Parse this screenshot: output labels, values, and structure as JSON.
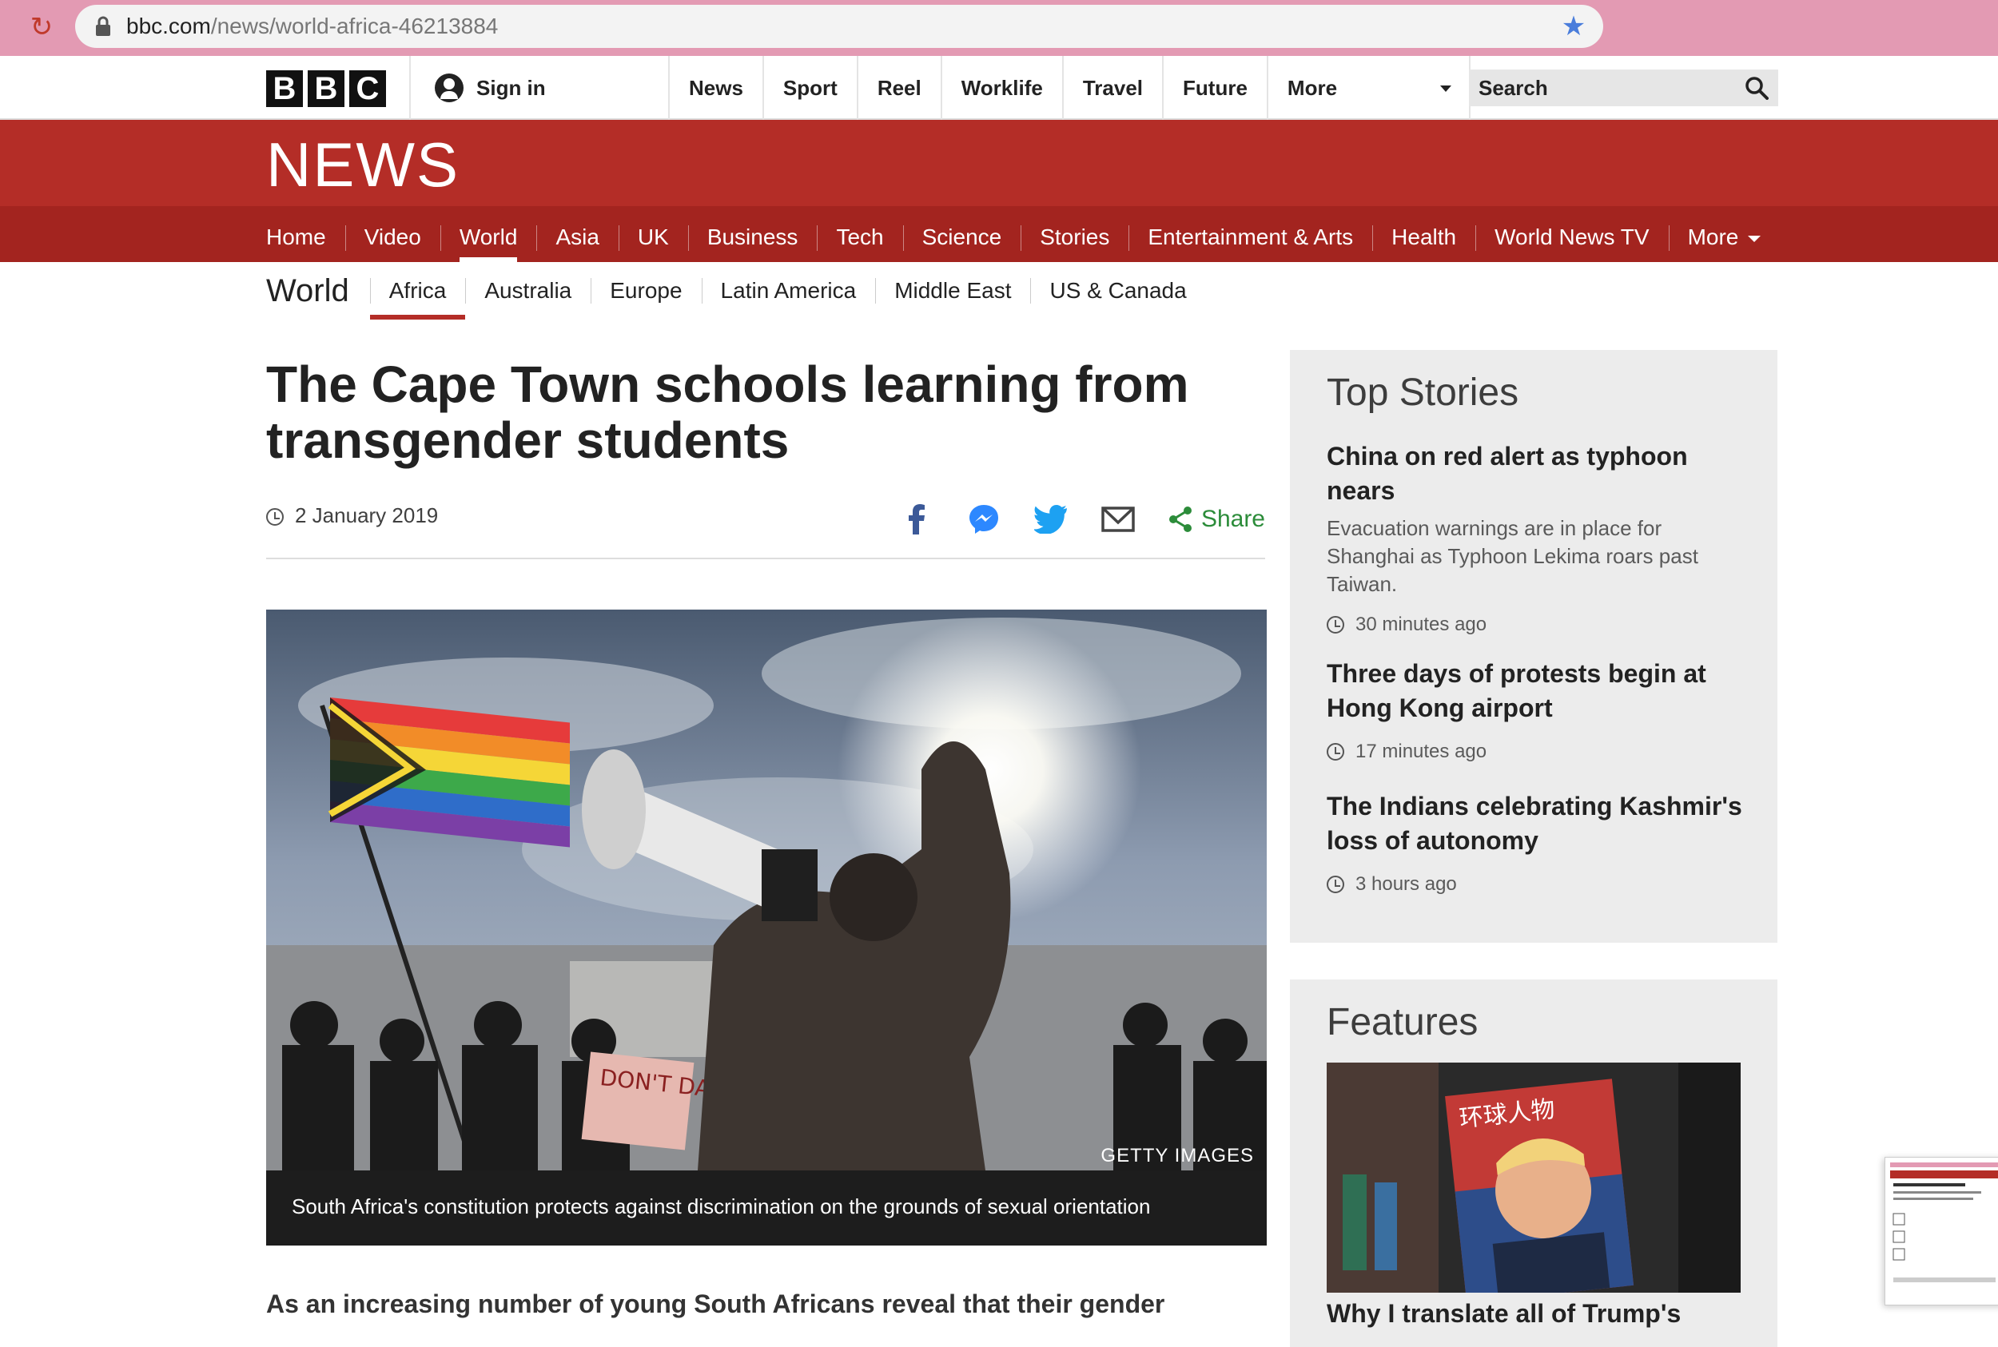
{
  "browser": {
    "url_domain": "bbc.com",
    "url_path": "/news/world-africa-46213884"
  },
  "bbc_topbar": {
    "logo_letters": [
      "B",
      "B",
      "C"
    ],
    "sign_in": "Sign in",
    "nav": [
      "News",
      "Sport",
      "Reel",
      "Worklife",
      "Travel",
      "Future",
      "More"
    ],
    "search_placeholder": "Search"
  },
  "news_header": {
    "logo": "NEWS",
    "nav": [
      "Home",
      "Video",
      "World",
      "Asia",
      "UK",
      "Business",
      "Tech",
      "Science",
      "Stories",
      "Entertainment & Arts",
      "Health",
      "World News TV",
      "More"
    ],
    "active": "World"
  },
  "world_nav": {
    "title": "World",
    "items": [
      "Africa",
      "Australia",
      "Europe",
      "Latin America",
      "Middle East",
      "US & Canada"
    ],
    "active": "Africa"
  },
  "article": {
    "headline": "The Cape Town schools learning from transgender students",
    "date": "2 January 2019",
    "share_label": "Share",
    "image_credit": "GETTY IMAGES",
    "image_caption": "South Africa's constitution protects against discrimination on the grounds of sexual orientation",
    "sign_text": "DON'T DARE!",
    "lead": "As an increasing number of young South Africans reveal that their gender"
  },
  "sidebar": {
    "top_stories_title": "Top Stories",
    "stories": [
      {
        "title": "China on red alert as typhoon nears",
        "summary": "Evacuation warnings are in place for Shanghai as Typhoon Lekima roars past Taiwan.",
        "time": "30 minutes ago"
      },
      {
        "title": "Three days of protests begin at Hong Kong airport",
        "summary": "",
        "time": "17 minutes ago"
      },
      {
        "title": "The Indians celebrating Kashmir's loss of autonomy",
        "summary": "",
        "time": "3 hours ago"
      }
    ],
    "features_title": "Features",
    "feature_magazine_text": "环球人物",
    "feature_title": "Why I translate all of Trump's"
  },
  "colors": {
    "bbc_red": "#b42d27",
    "nav_red": "#a3241f",
    "share_green": "#2c8c3a",
    "browser_pink": "#e39ab3"
  }
}
